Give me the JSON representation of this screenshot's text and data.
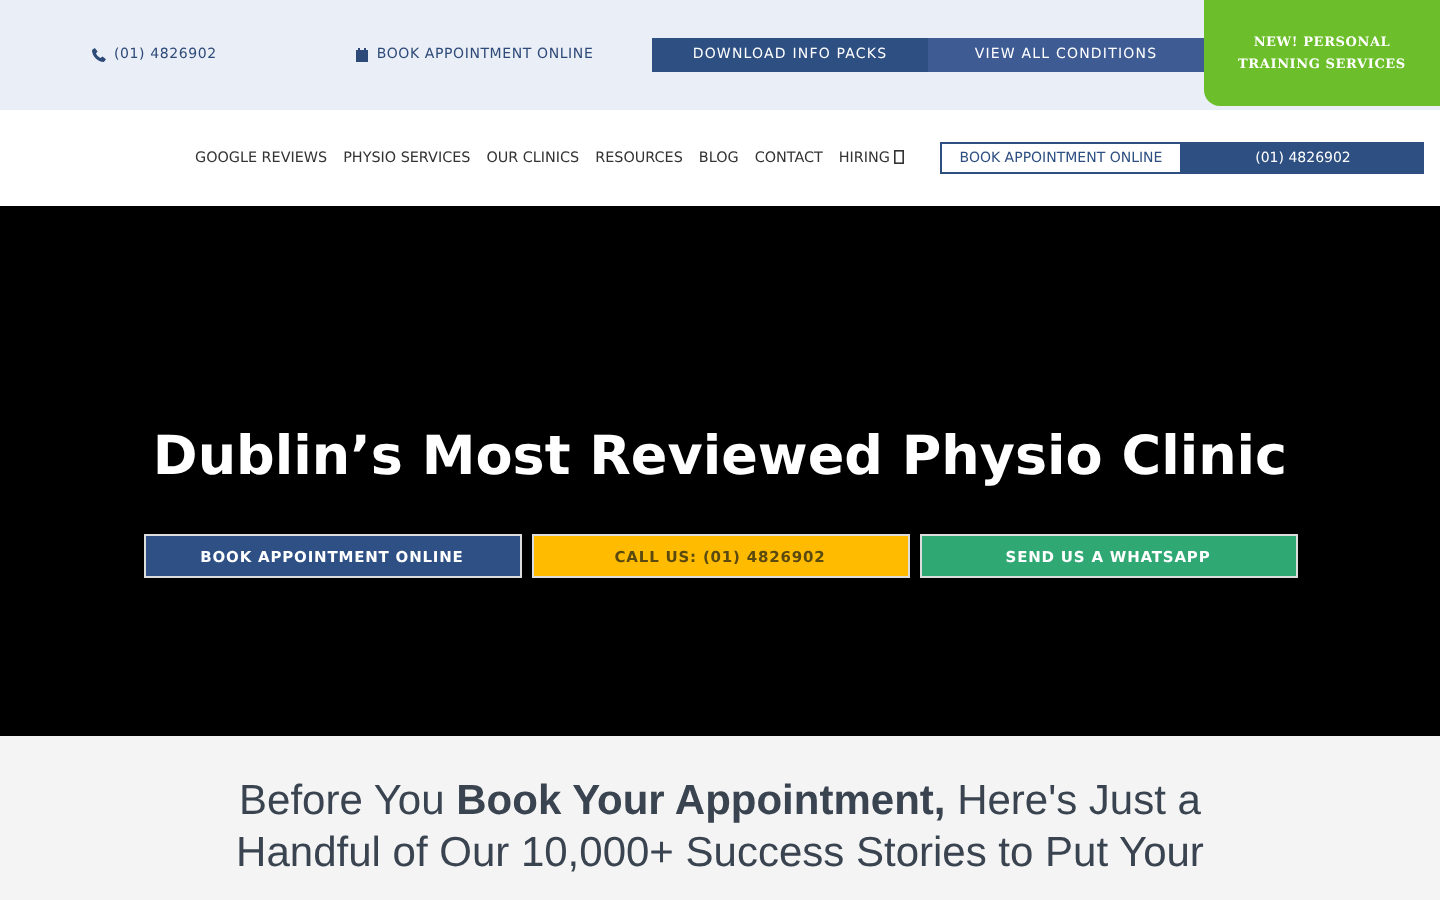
{
  "top_bar": {
    "phone": "(01) 4826902",
    "book_link": "BOOK APPOINTMENT ONLINE",
    "buttons": [
      "DOWNLOAD INFO PACKS",
      "VIEW ALL CONDITIONS"
    ],
    "promo_badge": "NEW! PERSONAL TRAINING SERVICES"
  },
  "nav": {
    "links": [
      {
        "label": "GOOGLE REVIEWS",
        "kind": "link"
      },
      {
        "label": "PHYSIO SERVICES",
        "kind": "link"
      },
      {
        "label": "OUR CLINICS",
        "kind": "link"
      },
      {
        "label": "RESOURCES",
        "kind": "link"
      },
      {
        "label": "BLOG",
        "kind": "link"
      },
      {
        "label": "CONTACT",
        "kind": "link"
      },
      {
        "label": "HIRING",
        "kind": "icon-link"
      }
    ],
    "buttons": [
      {
        "label": "BOOK APPOINTMENT ONLINE",
        "kind": "outline"
      },
      {
        "label": "(01) 4826902",
        "kind": "filled"
      }
    ]
  },
  "hero": {
    "title": "Dublin’s Most Reviewed Physio Clinic",
    "buttons": [
      {
        "label": "BOOK APPOINTMENT ONLINE",
        "color": "#2e5085"
      },
      {
        "label": "CALL US: (01) 4826902",
        "color": "#ffbb00"
      },
      {
        "label": "SEND US A WHATSAPP",
        "color": "#2fa873"
      }
    ]
  },
  "section": {
    "heading": "Before You **Book Your Appointment,** Here's Just a Handful of Our 10,000+ Success Stories to Put Your"
  }
}
